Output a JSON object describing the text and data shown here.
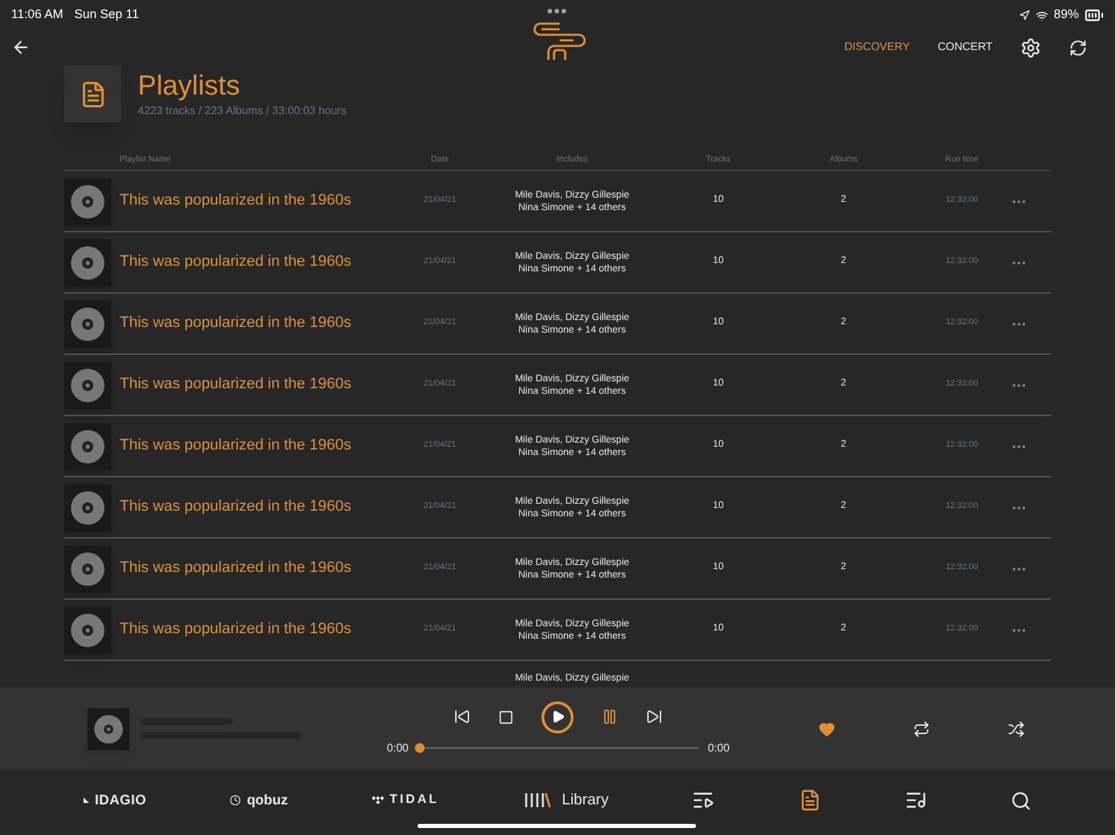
{
  "status_bar": {
    "time": "11:06 AM",
    "date": "Sun Sep 11",
    "battery": "89%"
  },
  "top_nav": [
    {
      "label": "DISCOVERY",
      "selected": true
    },
    {
      "label": "CONCERT",
      "selected": false
    }
  ],
  "header": {
    "title": "Playlists",
    "subtitle": "4223 tracks / 223 Albums / 33:00:03 hours"
  },
  "table": {
    "columns": [
      "Playlist Name",
      "Date",
      "Includes",
      "Tracks",
      "Albums",
      "Run time"
    ],
    "rows": [
      {
        "name": "This was popularized in the 1960s",
        "date": "21/04/21",
        "includes": [
          "Mile Davis, Dizzy Gillespie",
          "Nina Simone + 14 others"
        ],
        "tracks": "10",
        "albums": "2",
        "run_time": "12:32:00"
      },
      {
        "name": "This was popularized in the 1960s",
        "date": "21/04/21",
        "includes": [
          "Mile Davis, Dizzy Gillespie",
          "Nina Simone + 14 others"
        ],
        "tracks": "10",
        "albums": "2",
        "run_time": "12:32:00"
      },
      {
        "name": "This was popularized in the 1960s",
        "date": "21/04/21",
        "includes": [
          "Mile Davis, Dizzy Gillespie",
          "Nina Simone + 14 others"
        ],
        "tracks": "10",
        "albums": "2",
        "run_time": "12:32:00"
      },
      {
        "name": "This was popularized in the 1960s",
        "date": "21/04/21",
        "includes": [
          "Mile Davis, Dizzy Gillespie",
          "Nina Simone + 14 others"
        ],
        "tracks": "10",
        "albums": "2",
        "run_time": "12:32:00"
      },
      {
        "name": "This was popularized in the 1960s",
        "date": "21/04/21",
        "includes": [
          "Mile Davis, Dizzy Gillespie",
          "Nina Simone + 14 others"
        ],
        "tracks": "10",
        "albums": "2",
        "run_time": "12:32:00"
      },
      {
        "name": "This was popularized in the 1960s",
        "date": "21/04/21",
        "includes": [
          "Mile Davis, Dizzy Gillespie",
          "Nina Simone + 14 others"
        ],
        "tracks": "10",
        "albums": "2",
        "run_time": "12:32:00"
      },
      {
        "name": "This was popularized in the 1960s",
        "date": "21/04/21",
        "includes": [
          "Mile Davis, Dizzy Gillespie",
          "Nina Simone + 14 others"
        ],
        "tracks": "10",
        "albums": "2",
        "run_time": "12:32:00"
      },
      {
        "name": "This was popularized in the 1960s",
        "date": "21/04/21",
        "includes": [
          "Mile Davis, Dizzy Gillespie",
          "Nina Simone + 14 others"
        ],
        "tracks": "10",
        "albums": "2",
        "run_time": "12:32:00"
      }
    ],
    "peek_row": {
      "includes": "Mile Davis, Dizzy Gillespie"
    }
  },
  "player": {
    "liked": true,
    "progress": {
      "elapsed": "0:00",
      "total": "0:00",
      "level": 0
    }
  },
  "bottom_nav": [
    {
      "kind": "idagio",
      "label": "IDAGIO",
      "selected": false
    },
    {
      "kind": "qobuz",
      "label": "qobuz",
      "selected": false
    },
    {
      "kind": "tidal",
      "label": "TIDAL",
      "selected": false
    },
    {
      "kind": "library",
      "label": "Library",
      "selected": false
    },
    {
      "kind": "albums",
      "selected": false
    },
    {
      "kind": "playlists",
      "selected": true
    },
    {
      "kind": "music",
      "selected": false
    },
    {
      "kind": "search",
      "selected": false
    }
  ]
}
